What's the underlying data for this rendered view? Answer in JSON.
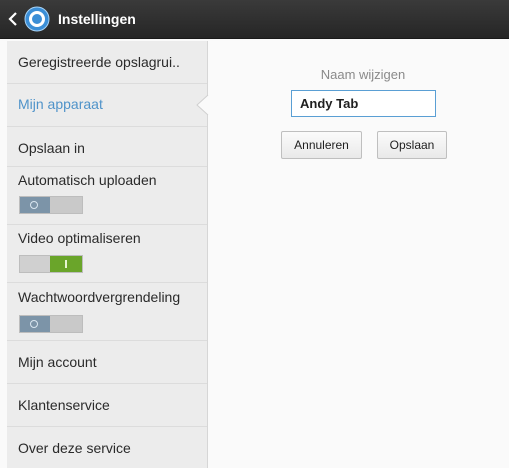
{
  "appbar": {
    "title": "Instellingen",
    "back_icon": "chevron-left-icon",
    "app_icon": "circle-ring-icon",
    "accent": "#3b8ed6"
  },
  "sidebar": {
    "items": [
      {
        "label": "Geregistreerde opslagrui.."
      },
      {
        "label": "Mijn apparaat",
        "active": true,
        "active_color": "#4f93c9"
      },
      {
        "label": "Opslaan in"
      },
      {
        "label": "Automatisch uploaden",
        "toggle": "off"
      },
      {
        "label": "Video optimaliseren",
        "toggle": "on"
      },
      {
        "label": "Wachtwoordvergrendeling",
        "toggle": "off"
      },
      {
        "label": "Mijn account"
      },
      {
        "label": "Klantenservice"
      },
      {
        "label": "Over deze service"
      }
    ]
  },
  "form": {
    "label": "Naam wijzigen",
    "name_value": "Andy Tab",
    "cancel_label": "Annuleren",
    "save_label": "Opslaan"
  }
}
